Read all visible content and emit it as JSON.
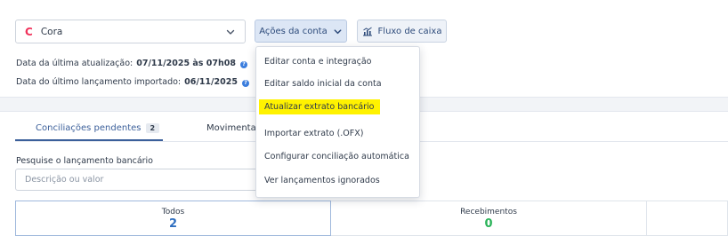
{
  "account": {
    "bank_logo": "C",
    "name": "Cora"
  },
  "buttons": {
    "acoes": "Ações da conta",
    "fluxo": "Fluxo de caixa"
  },
  "info": {
    "last_update_label": "Data da última atualização:",
    "last_update_value": "07/11/2025 às 07h08",
    "last_entry_label": "Data do último lançamento importado:",
    "last_entry_value": "06/11/2025"
  },
  "tabs": {
    "pending_label": "Conciliações pendentes",
    "pending_count": "2",
    "movements_label": "Movimentaçõ"
  },
  "search": {
    "label": "Pesquise o lançamento bancário",
    "placeholder": "Descrição ou valor"
  },
  "summary": [
    {
      "title": "Todos",
      "value": "2"
    },
    {
      "title": "Recebimentos",
      "value": "0"
    }
  ],
  "menu": {
    "items": [
      "Editar conta e integração",
      "Editar saldo inicial da conta",
      "Atualizar extrato bancário",
      "Importar extrato (.OFX)",
      "Configurar conciliação automática",
      "Ver lançamentos ignorados"
    ],
    "highlighted_index": 2
  },
  "colors": {
    "accent": "#3b5f9a",
    "bank_logo": "#f0325b",
    "highlight": "#fff200",
    "positive": "#2bb35a",
    "total": "#2f6fc0"
  }
}
